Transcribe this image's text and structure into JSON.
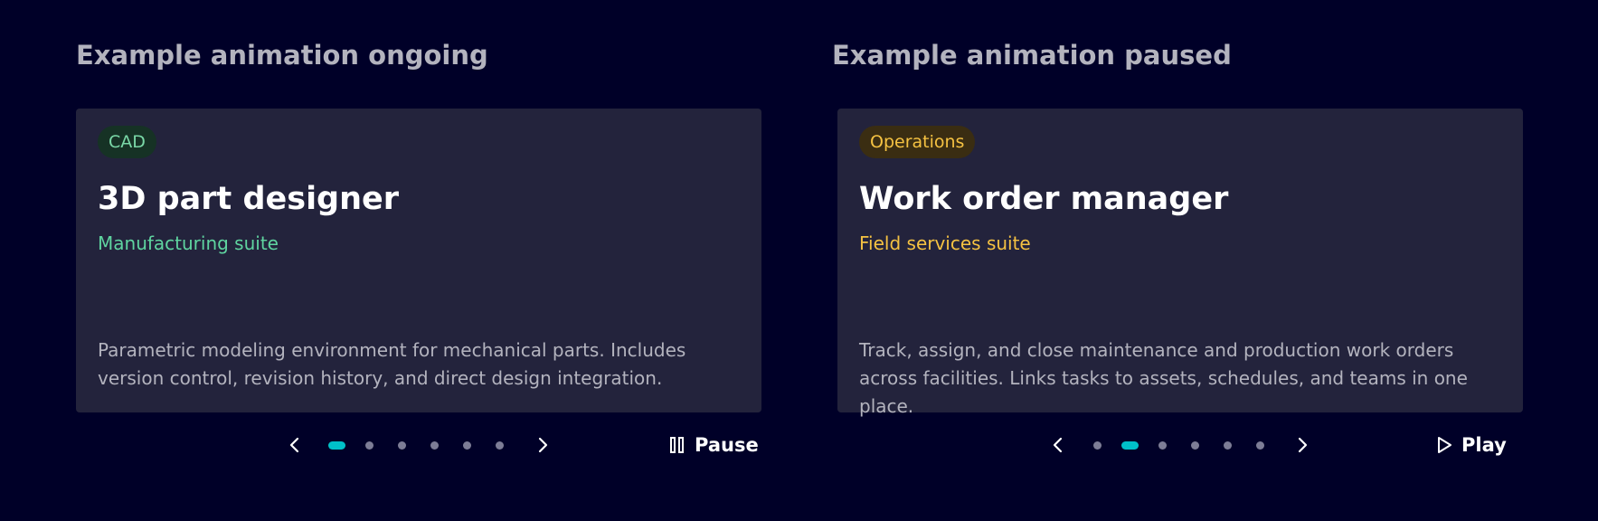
{
  "colors": {
    "background": "#000028",
    "card": "#23233c",
    "accent": "#00c1c9",
    "green": "#5fd4a0",
    "yellow": "#f5c242"
  },
  "panels": [
    {
      "heading": "Example animation ongoing",
      "card": {
        "tag": "CAD",
        "title": "3D part designer",
        "subtitle": "Manufacturing suite",
        "description": "Parametric modeling environment for mechanical parts. Includes version control, revision history, and direct design integration."
      },
      "pagination": {
        "total": 6,
        "active": 1
      },
      "toggle": {
        "label": "Pause",
        "icon": "pause-icon"
      }
    },
    {
      "heading": "Example animation paused",
      "card": {
        "tag": "Operations",
        "title": "Work order manager",
        "subtitle": "Field services suite",
        "description": "Track, assign, and close maintenance and production work orders across facilities. Links tasks to assets, schedules, and teams in one place."
      },
      "pagination": {
        "total": 6,
        "active": 2
      },
      "toggle": {
        "label": "Play",
        "icon": "play-icon"
      }
    }
  ]
}
